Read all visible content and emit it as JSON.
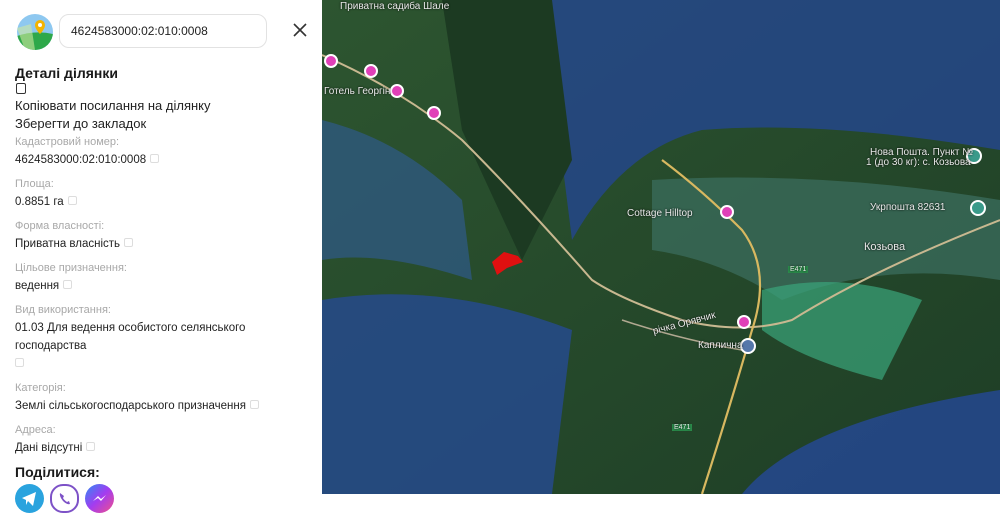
{
  "search": {
    "value": "4624583000:02:010:0008"
  },
  "details": {
    "title": "Деталі ділянки",
    "copy_link": "Копіювати посилання на ділянку",
    "bookmark": "Зберегти до закладок",
    "fields": [
      {
        "label": "Кадастровий номер:",
        "value": "4624583000:02:010:0008"
      },
      {
        "label": "Площа:",
        "value": "0.8851 га"
      },
      {
        "label": "Форма власності:",
        "value": "Приватна власність"
      },
      {
        "label": "Цільове призначення:",
        "value": "ведення"
      },
      {
        "label": "Вид використання:",
        "value": "01.03 Для ведення особистого селянського господарства"
      },
      {
        "label": "Категорія:",
        "value": "Землі сільськогосподарського призначення"
      },
      {
        "label": "Адреса:",
        "value": "Дані відсутні"
      }
    ]
  },
  "share": {
    "title": "Поділитися:",
    "items": [
      {
        "name": "telegram",
        "color": "#2aa3de"
      },
      {
        "name": "viber",
        "color": "#7d52c7"
      },
      {
        "name": "messenger",
        "color": "#8a3cf0"
      }
    ]
  },
  "map": {
    "labels": {
      "top": "Приватна садиба Шале",
      "hotel": "Готель Георгін",
      "cottage": "Cottage Hilltop",
      "nova": "Нова Пошта. Пункт №",
      "nova2": "1 (до 30 кг): с. Козьова",
      "ukr": "Укрпошта 82631",
      "village": "Козьова",
      "river": "річка Орявчик",
      "chapel": "Каплична",
      "road": "E471",
      "road2": "E471"
    },
    "parcel_color": "#e01010"
  }
}
